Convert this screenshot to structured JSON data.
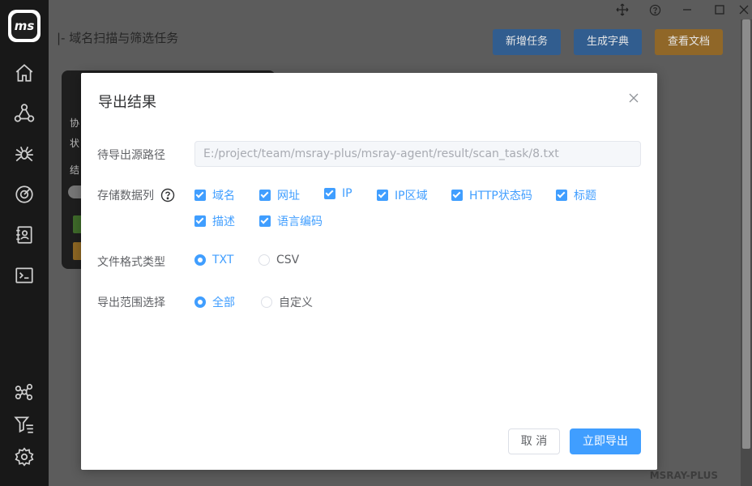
{
  "sidebar": {
    "logo_text": "ms",
    "icons": [
      "home-icon",
      "network-icon",
      "spider-icon",
      "radar-icon",
      "contacts-icon",
      "terminal-icon",
      "nodes-icon",
      "filter-list-icon",
      "settings-icon"
    ]
  },
  "header": {
    "title": "|- 域名扫描与筛选任务",
    "buttons": {
      "new_task": "新增任务",
      "gen_dict": "生成字典",
      "view_docs": "查看文档"
    }
  },
  "background_card": {
    "labels": [
      "协",
      "状",
      "结"
    ]
  },
  "watermark": "MSRAY-PLUS",
  "modal": {
    "title": "导出结果",
    "source_path_label": "待导出源路径",
    "source_path_value": "E:/project/team/msray-plus/msray-agent/result/scan_task/8.txt",
    "columns_label": "存储数据列",
    "columns": [
      {
        "label": "域名",
        "checked": true
      },
      {
        "label": "网址",
        "checked": true
      },
      {
        "label": "IP",
        "checked": true
      },
      {
        "label": "IP区域",
        "checked": true
      },
      {
        "label": "HTTP状态码",
        "checked": true
      },
      {
        "label": "标题",
        "checked": true
      },
      {
        "label": "描述",
        "checked": true
      },
      {
        "label": "语言编码",
        "checked": true
      }
    ],
    "format_label": "文件格式类型",
    "formats": [
      {
        "label": "TXT",
        "selected": true
      },
      {
        "label": "CSV",
        "selected": false
      }
    ],
    "range_label": "导出范围选择",
    "ranges": [
      {
        "label": "全部",
        "selected": true
      },
      {
        "label": "自定义",
        "selected": false
      }
    ],
    "cancel_label": "取 消",
    "export_label": "立即导出"
  },
  "colors": {
    "primary": "#409eff",
    "sidebar_bg": "#181818",
    "warning": "#e6a23c"
  }
}
